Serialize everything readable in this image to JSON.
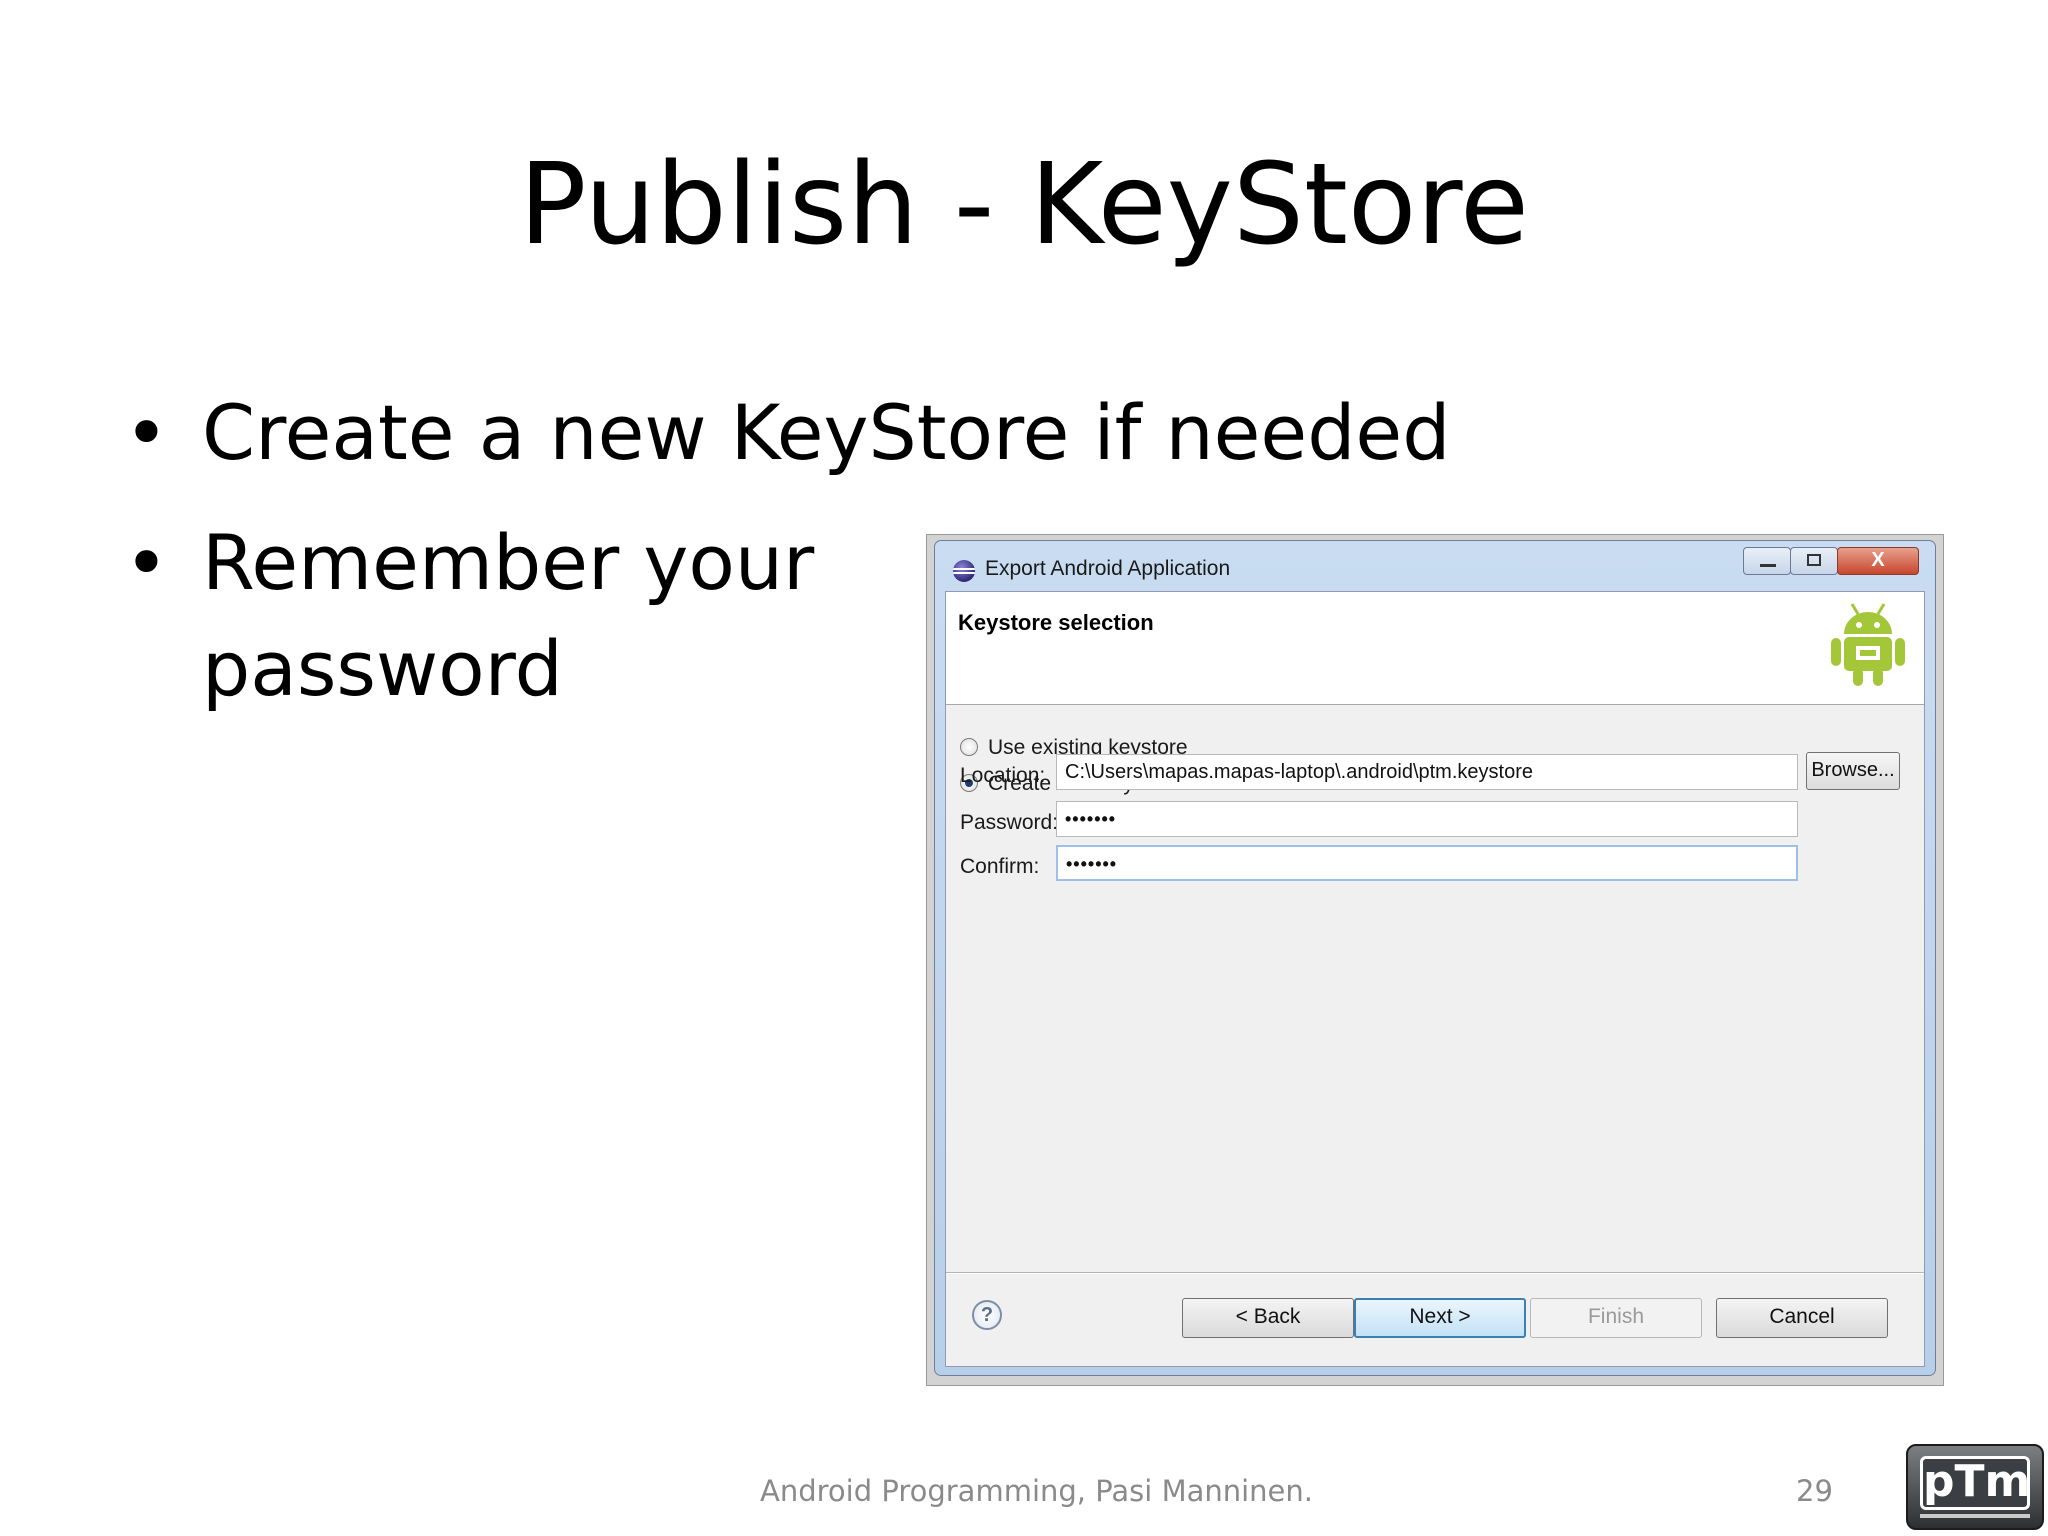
{
  "slide": {
    "title": "Publish - KeyStore",
    "bullets": [
      "Create a new KeyStore if needed",
      "Remember your password"
    ],
    "footer": "Android Programming, Pasi Manninen.",
    "page_number": "29",
    "logo_text": "pTm"
  },
  "dialog": {
    "title": "Export Android Application",
    "window_buttons": {
      "minimize": "",
      "maximize": "",
      "close": "X"
    },
    "header_title": "Keystore selection",
    "radio_existing": "Use existing keystore",
    "radio_new": "Create new keystore",
    "selected_option": "Create new keystore",
    "location_label": "Location:",
    "location_value": "C:\\Users\\mapas.mapas-laptop\\.android\\ptm.keystore",
    "browse_label": "Browse...",
    "password_label": "Password:",
    "password_value": "•••••••",
    "confirm_label": "Confirm:",
    "confirm_value": "•••••••",
    "help_symbol": "?",
    "back_label": "< Back",
    "next_label": "Next >",
    "finish_label": "Finish",
    "cancel_label": "Cancel"
  },
  "icons": [
    "eclipse-app-icon",
    "android-icon",
    "help-icon",
    "ptm-logo"
  ],
  "colors": {
    "window_frame": "#b8cfe9",
    "close_button": "#c7462e",
    "android_green": "#a4c639",
    "default_button": "#3c7fb1"
  }
}
